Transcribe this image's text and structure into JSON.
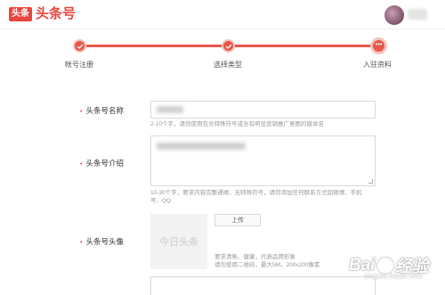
{
  "header": {
    "logo_badge": "头条",
    "logo_text": "头条号"
  },
  "steps": [
    {
      "label": "帐号注册",
      "state": "done"
    },
    {
      "label": "选择类型",
      "state": "done"
    },
    {
      "label": "入驻资料",
      "state": "current"
    }
  ],
  "form": {
    "name": {
      "label": "头条号名称",
      "hint": "2-10个字，请勿使用包含特殊符号或含有明显营销推广意图的媒体名"
    },
    "intro": {
      "label": "头条号介绍",
      "hint_line1": "10-30个字，要求内容完整通顺，无特殊符号，请勿添加任何联系方式如微博、手机",
      "hint_line2": "号、QQ"
    },
    "avatar": {
      "label": "头条号头像",
      "placeholder": "今日头条",
      "upload_label": "上传",
      "hint_line1": "要求清晰、健康，代表品牌形象",
      "hint_line2": "请勿使用二维码，最大5M，200x200像素"
    }
  },
  "watermark": {
    "text_a": "Bai",
    "text_b": "经验",
    "sub": "jingyan.baidu.com"
  },
  "colors": {
    "brand": "#e8453c",
    "progress": "#e8574a",
    "hint": "#999999"
  }
}
